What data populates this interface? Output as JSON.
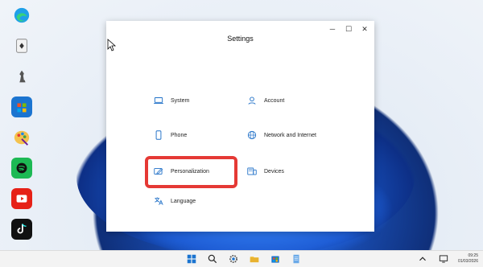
{
  "window": {
    "title": "Settings",
    "controls": [
      "minimize",
      "maximize",
      "close"
    ]
  },
  "settings": {
    "system": "System",
    "account": "Account",
    "phone": "Phone",
    "network": "Network and Internet",
    "personalization": "Personalization",
    "devices": "Devices",
    "language": "Language"
  },
  "highlight_color": "#e53935",
  "taskbar": {
    "time": "09:25",
    "date": "01/03/2026"
  },
  "desktop_icons": [
    "edge-icon",
    "solitaire-icon",
    "chess-icon",
    "store-icon",
    "paint-icon",
    "spotify-icon",
    "youtube-icon",
    "tiktok-icon"
  ]
}
